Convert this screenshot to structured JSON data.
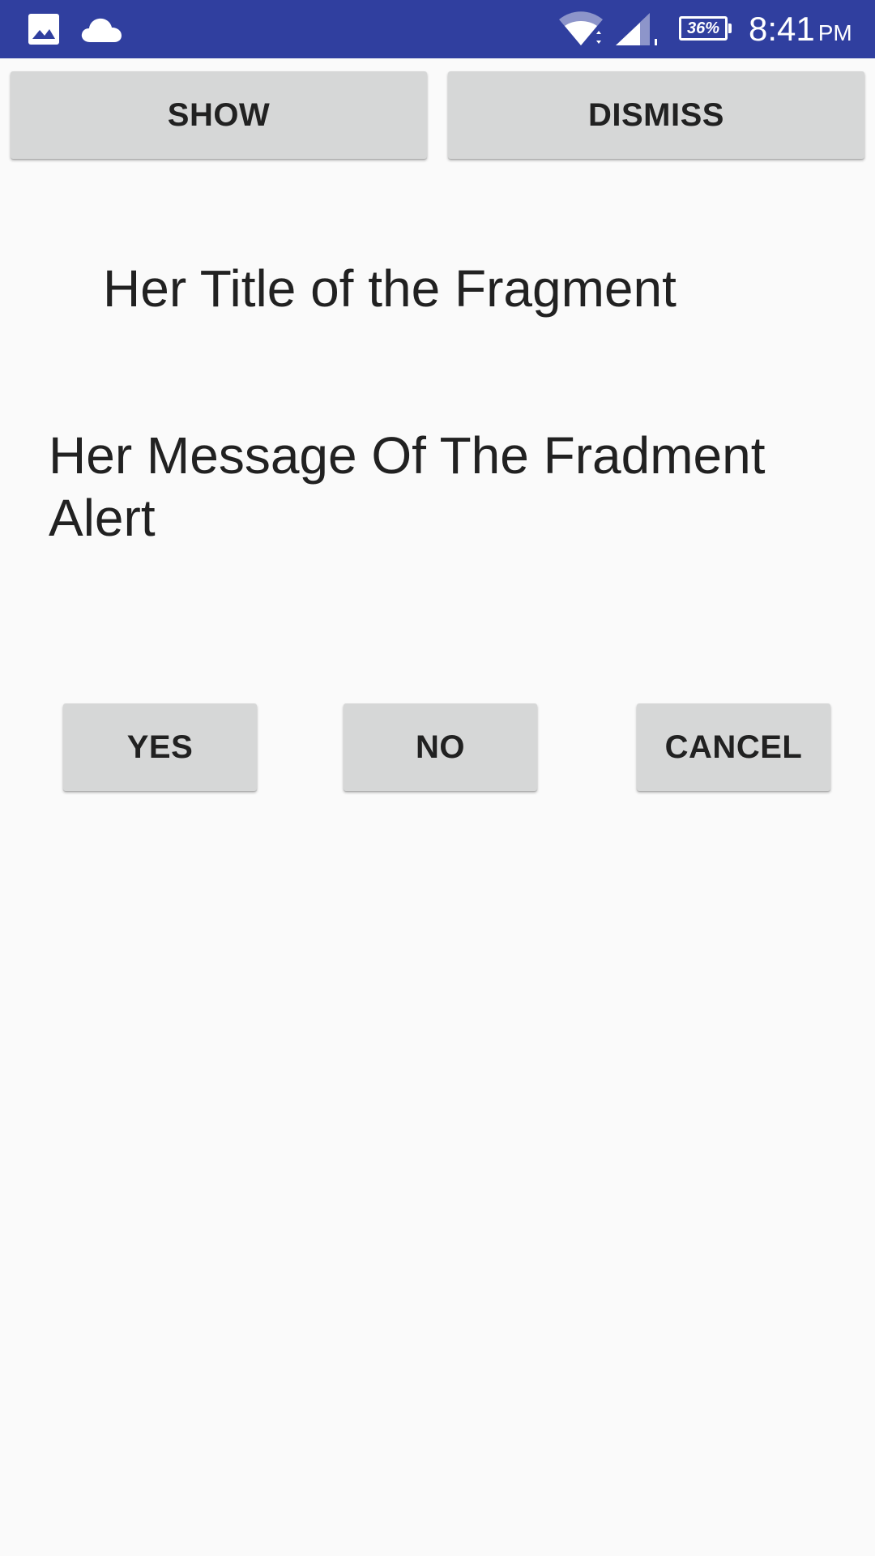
{
  "status_bar": {
    "icons": [
      "image-icon",
      "cloud-icon",
      "wifi-icon",
      "signal-icon"
    ],
    "battery_label": "36%",
    "time": "8:41",
    "ampm": "PM",
    "color": "#303f9f"
  },
  "top_buttons": {
    "show_label": "SHOW",
    "dismiss_label": "DISMISS"
  },
  "fragment": {
    "title": "Her Title of the Fragment",
    "message": "Her Message Of The Fradment Alert",
    "yes_label": "YES",
    "no_label": "NO",
    "cancel_label": "CANCEL"
  },
  "colors": {
    "background": "#fafafa",
    "button": "#d6d7d7",
    "text": "#212121"
  }
}
